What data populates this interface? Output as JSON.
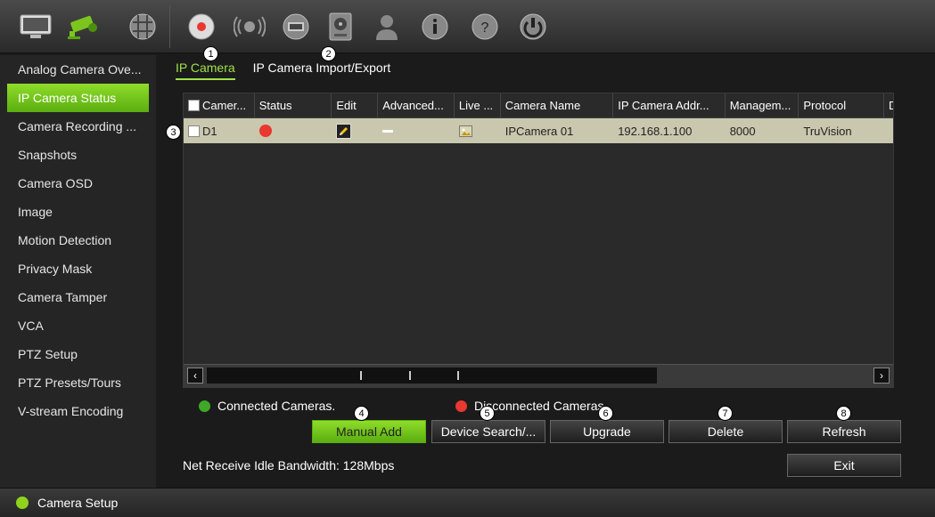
{
  "toolbar": {
    "icons": [
      "monitor-icon",
      "camera-icon",
      "network-icon",
      "record-icon",
      "alarm-icon",
      "device-icon",
      "hdd-icon",
      "user-icon",
      "info-icon",
      "help-icon",
      "power-icon"
    ]
  },
  "sidebar": {
    "items": [
      {
        "label": "Analog Camera Ove..."
      },
      {
        "label": "IP Camera Status"
      },
      {
        "label": "Camera Recording ..."
      },
      {
        "label": "Snapshots"
      },
      {
        "label": "Camera OSD"
      },
      {
        "label": "Image"
      },
      {
        "label": "Motion Detection"
      },
      {
        "label": "Privacy Mask"
      },
      {
        "label": "Camera Tamper"
      },
      {
        "label": "VCA"
      },
      {
        "label": "PTZ Setup"
      },
      {
        "label": "PTZ Presets/Tours"
      },
      {
        "label": "V-stream Encoding"
      }
    ]
  },
  "tabs": [
    {
      "label": "IP Camera"
    },
    {
      "label": "IP Camera Import/Export"
    }
  ],
  "table": {
    "headers": [
      "Camer...",
      "Status",
      "Edit",
      "Advanced...",
      "Live ...",
      "Camera Name",
      "IP Camera Addr...",
      "Managem...",
      "Protocol",
      "D"
    ],
    "rows": [
      {
        "camera": "D1",
        "camera_name": "IPCamera 01",
        "ip": "192.168.1.100",
        "management": "8000",
        "protocol": "TruVision"
      }
    ]
  },
  "legend": {
    "connected": "Connected Cameras.",
    "disconnected": "Disconnected Cameras."
  },
  "buttons": {
    "manual_add": "Manual Add",
    "device_search": "Device Search/...",
    "upgrade": "Upgrade",
    "delete": "Delete",
    "refresh": "Refresh",
    "exit": "Exit"
  },
  "callouts": [
    "1",
    "2",
    "3",
    "4",
    "5",
    "6",
    "7",
    "8"
  ],
  "bandwidth": "Net Receive Idle Bandwidth: 128Mbps",
  "statusbar": {
    "label": "Camera Setup"
  },
  "colors": {
    "accent": "#7cc51f",
    "disconnected": "#e8382f",
    "connected": "#3ea829"
  }
}
